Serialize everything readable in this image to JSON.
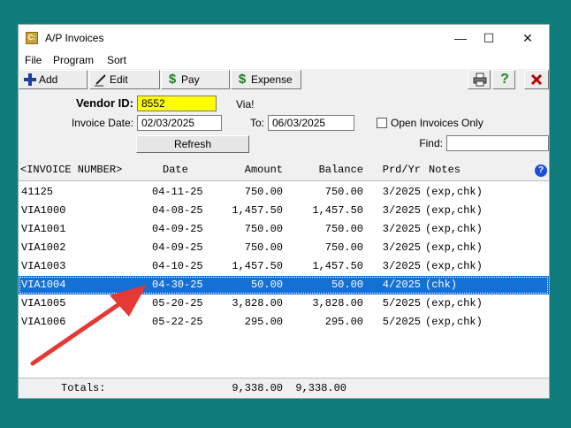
{
  "window": {
    "title": "A/P Invoices",
    "icon_letter": "C:",
    "minimize": "—",
    "maximize": "☐",
    "close": "✕"
  },
  "menu": [
    "File",
    "Program",
    "Sort"
  ],
  "toolbar": {
    "add_label": "Add",
    "edit_label": "Edit",
    "pay_label": "Pay",
    "expense_label": "Expense"
  },
  "form": {
    "vendor_label": "Vendor ID:",
    "vendor_value": "8552",
    "vendor_name": "Via!",
    "invoice_date_label": "Invoice Date:",
    "invoice_date_from": "02/03/2025",
    "to_label": "To:",
    "invoice_date_to": "06/03/2025",
    "open_only_label": "Open Invoices Only",
    "open_only_checked": false,
    "find_label": "Find:",
    "find_value": "",
    "refresh_label": "Refresh"
  },
  "grid": {
    "headers": {
      "number": "<INVOICE NUMBER>",
      "date": "Date",
      "amount": "Amount",
      "balance": "Balance",
      "prd": "Prd/Yr",
      "notes": "Notes"
    },
    "rows": [
      {
        "number": "41125",
        "date": "04-11-25",
        "amount": "750.00",
        "balance": "750.00",
        "prd": "3/2025",
        "notes": "(exp,chk)"
      },
      {
        "number": "VIA1000",
        "date": "04-08-25",
        "amount": "1,457.50",
        "balance": "1,457.50",
        "prd": "3/2025",
        "notes": "(exp,chk)"
      },
      {
        "number": "VIA1001",
        "date": "04-09-25",
        "amount": "750.00",
        "balance": "750.00",
        "prd": "3/2025",
        "notes": "(exp,chk)"
      },
      {
        "number": "VIA1002",
        "date": "04-09-25",
        "amount": "750.00",
        "balance": "750.00",
        "prd": "3/2025",
        "notes": "(exp,chk)"
      },
      {
        "number": "VIA1003",
        "date": "04-10-25",
        "amount": "1,457.50",
        "balance": "1,457.50",
        "prd": "3/2025",
        "notes": "(exp,chk)"
      },
      {
        "number": "VIA1004",
        "date": "04-30-25",
        "amount": "50.00",
        "balance": "50.00",
        "prd": "4/2025",
        "notes": "(chk)"
      },
      {
        "number": "VIA1005",
        "date": "05-20-25",
        "amount": "3,828.00",
        "balance": "3,828.00",
        "prd": "5/2025",
        "notes": "(exp,chk)"
      },
      {
        "number": "VIA1006",
        "date": "05-22-25",
        "amount": "295.00",
        "balance": "295.00",
        "prd": "5/2025",
        "notes": "(exp,chk)"
      }
    ],
    "selected_row": 5
  },
  "totals": {
    "label": "Totals:",
    "amount": "9,338.00",
    "balance": "9,338.00"
  },
  "colors": {
    "selection": "#1570d6",
    "vendor_field": "#ffff00",
    "annotation_arrow": "#e53935",
    "background": "#0f7b7b"
  }
}
